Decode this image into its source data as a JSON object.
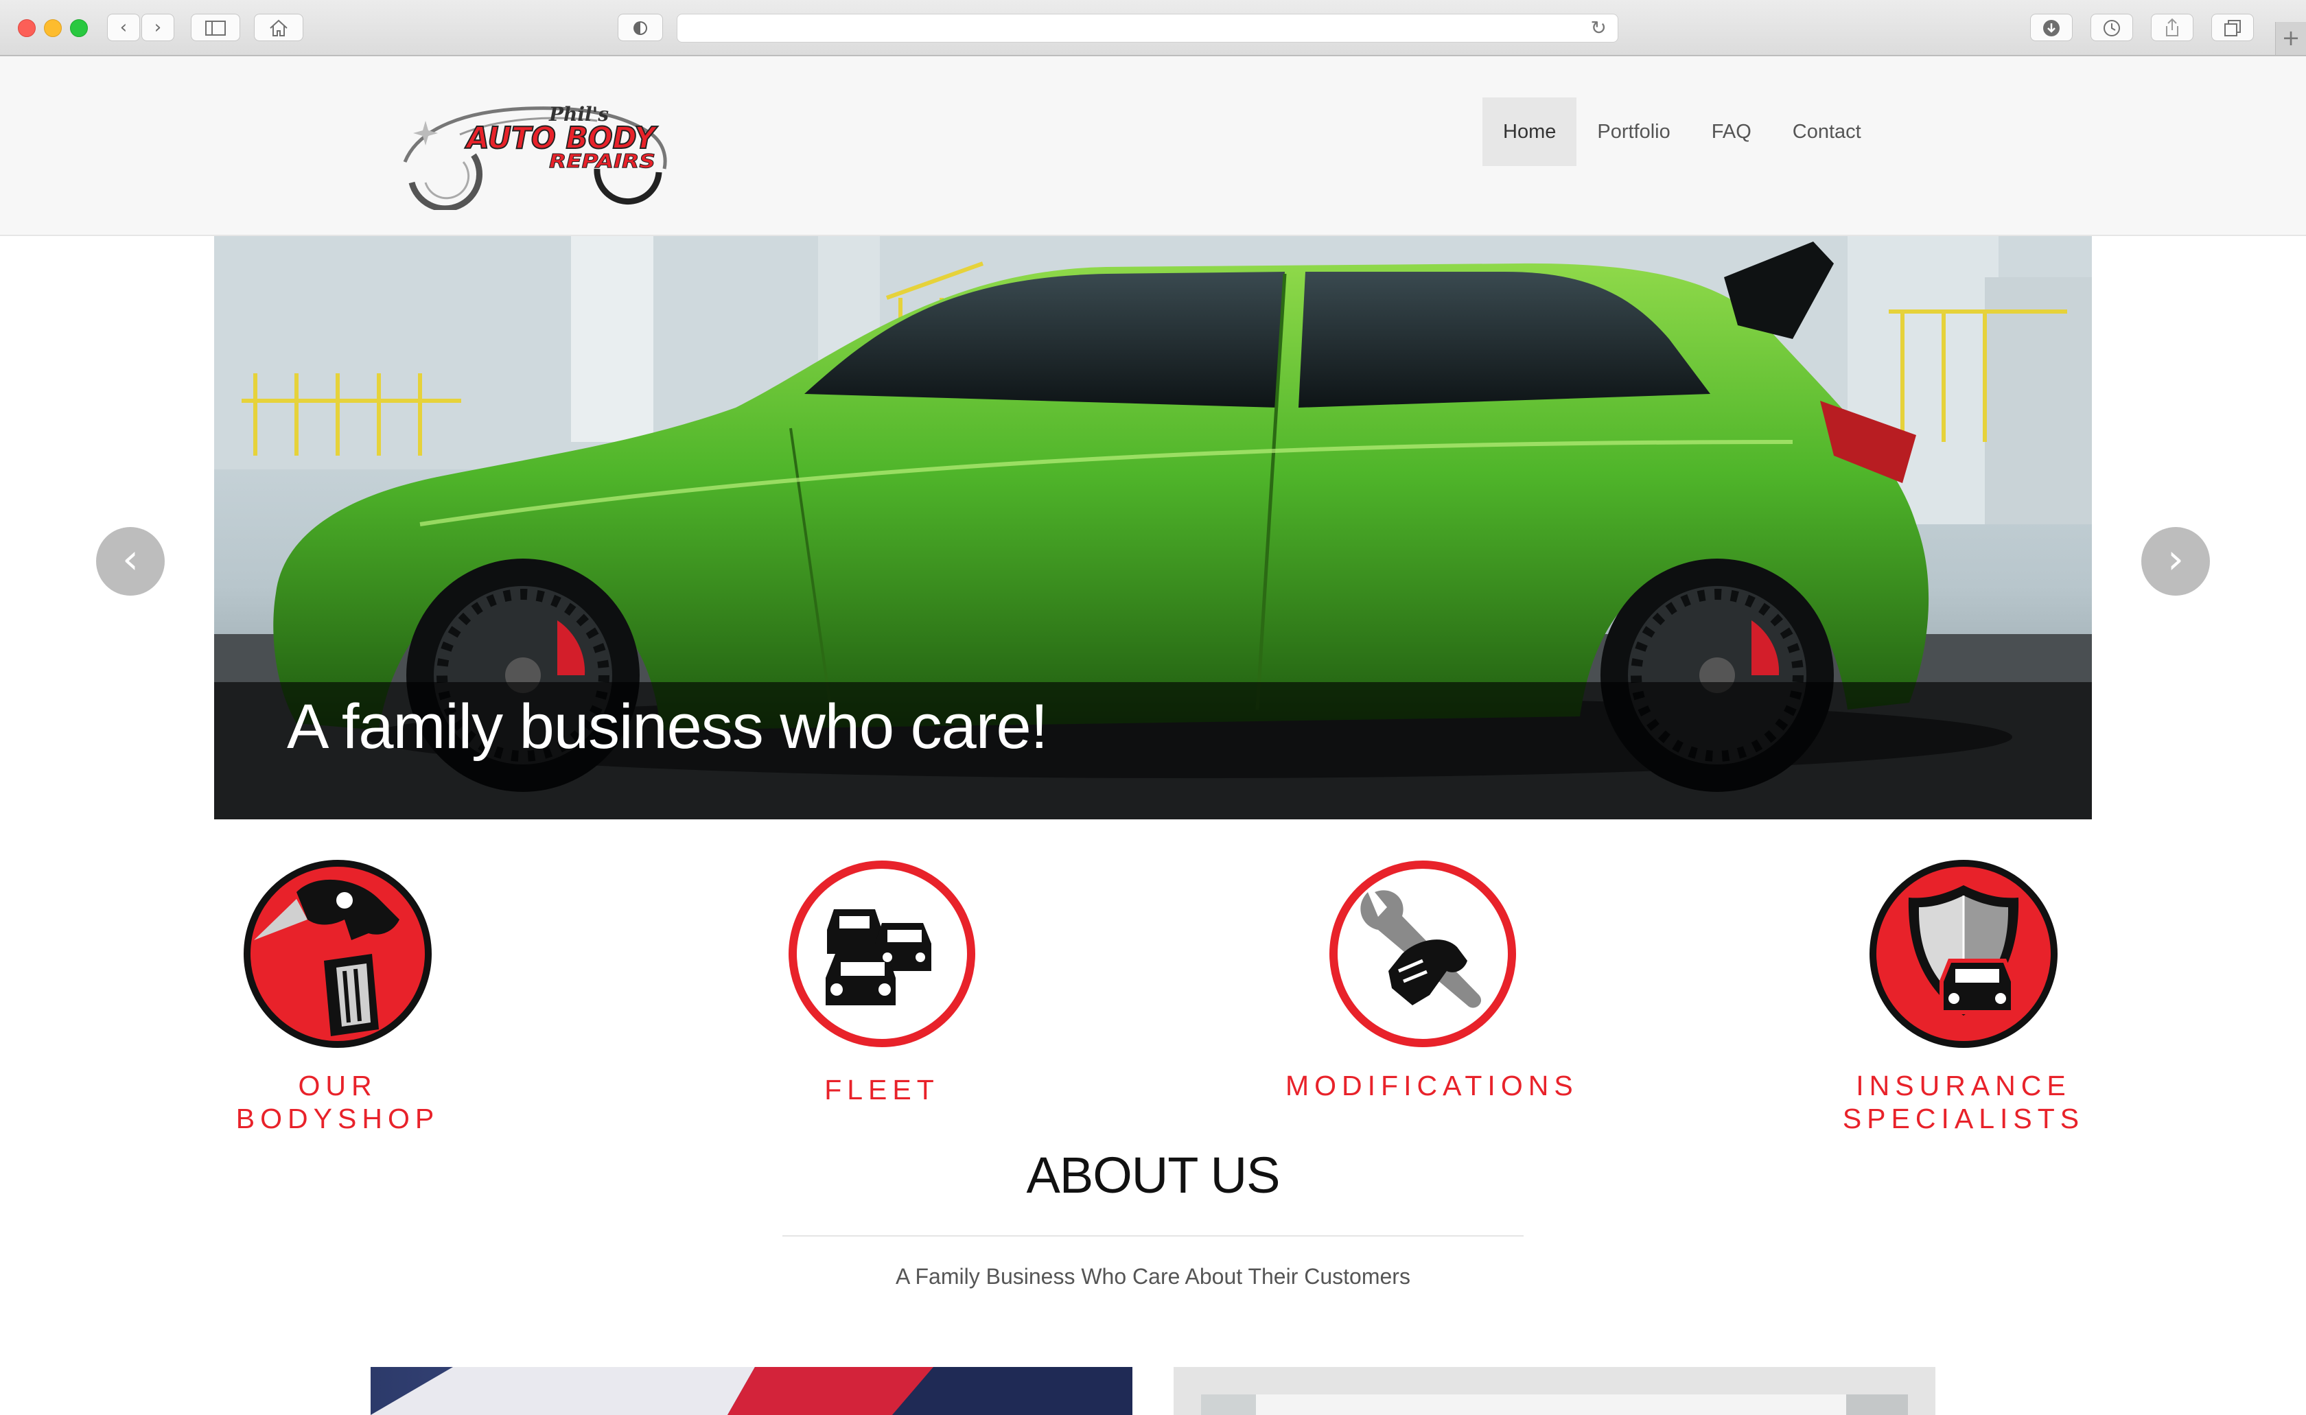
{
  "browser": {
    "url": "",
    "icons": [
      "back-icon",
      "forward-icon",
      "sidebar-icon",
      "home-icon",
      "shield-icon",
      "reload-icon",
      "download-icon",
      "history-icon",
      "share-icon",
      "tabs-icon",
      "new-tab-icon"
    ]
  },
  "header": {
    "logo": {
      "script": "Phil's",
      "line1": "AUTO BODY",
      "line2": "REPAIRS"
    },
    "nav": [
      {
        "label": "Home",
        "active": true
      },
      {
        "label": "Portfolio",
        "active": false
      },
      {
        "label": "FAQ",
        "active": false
      },
      {
        "label": "Contact",
        "active": false
      }
    ]
  },
  "hero": {
    "caption": "A family business who care!",
    "prev_icon": "‹",
    "next_icon": "›",
    "car_color": "#4fb52a"
  },
  "services": [
    {
      "line1": "OUR",
      "line2": "BODYSHOP",
      "icon": "spray-gun-icon"
    },
    {
      "line1": "FLEET",
      "line2": "",
      "icon": "fleet-cars-icon"
    },
    {
      "line1": "MODIFICATIONS",
      "line2": "",
      "icon": "wrench-icon"
    },
    {
      "line1": "INSURANCE",
      "line2": "SPECIALISTS",
      "icon": "shield-car-icon"
    }
  ],
  "about": {
    "title": "ABOUT US",
    "subtitle": "A Family Business Who Care About Their Customers"
  },
  "colors": {
    "accent": "#e8222a",
    "nav_active_bg": "#e7e7e7"
  }
}
